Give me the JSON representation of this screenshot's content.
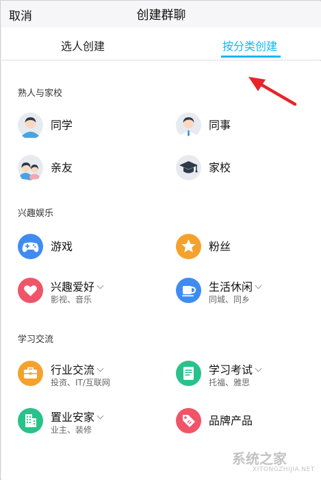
{
  "header": {
    "cancel_label": "取消",
    "title": "创建群聊"
  },
  "tabs": [
    {
      "label": "选人创建",
      "active": false
    },
    {
      "label": "按分类创建",
      "active": true
    }
  ],
  "colors": {
    "accent": "#12b7f5",
    "arrow": "#e8242a"
  },
  "sections": [
    {
      "title": "熟人与家校",
      "items": [
        {
          "label": "同学",
          "icon": "classmate-avatar-icon"
        },
        {
          "label": "同事",
          "icon": "colleague-avatar-icon"
        },
        {
          "label": "亲友",
          "icon": "family-avatar-icon"
        },
        {
          "label": "家校",
          "icon": "graduation-cap-icon"
        }
      ]
    },
    {
      "title": "兴趣娱乐",
      "items": [
        {
          "label": "游戏",
          "icon": "gamepad-icon",
          "color": "#3f8cf0"
        },
        {
          "label": "粉丝",
          "icon": "star-icon",
          "color": "#f4a22d"
        },
        {
          "label": "兴趣爱好",
          "sub": "影视、音乐",
          "icon": "heart-icon",
          "color": "#f05468"
        },
        {
          "label": "生活休闲",
          "sub": "同城、同乡",
          "icon": "coffee-cup-icon",
          "color": "#3f8cf0"
        }
      ]
    },
    {
      "title": "学习交流",
      "items": [
        {
          "label": "行业交流",
          "sub": "投资、IT/互联网",
          "icon": "briefcase-icon",
          "color": "#f4a22d"
        },
        {
          "label": "学习考试",
          "sub": "托福、雅思",
          "icon": "document-icon",
          "color": "#28c28a"
        },
        {
          "label": "置业安家",
          "sub": "业主、装修",
          "icon": "building-icon",
          "color": "#28c28a"
        },
        {
          "label": "品牌产品",
          "icon": "tag-icon",
          "color": "#f05468"
        }
      ]
    }
  ],
  "watermark": {
    "text": "系统之家",
    "sub": "XITONGZHIJIA.NET"
  }
}
